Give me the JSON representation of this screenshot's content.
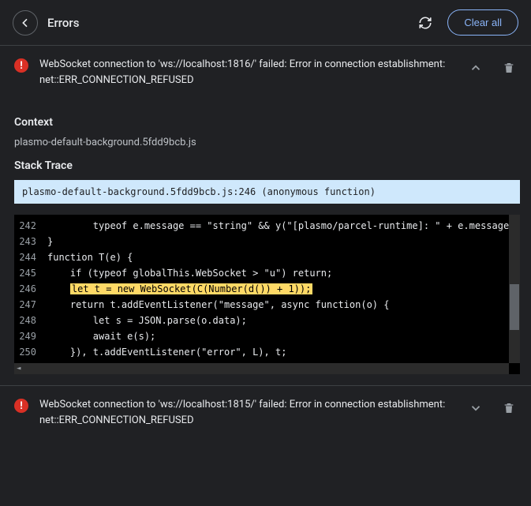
{
  "header": {
    "title": "Errors",
    "clear_label": "Clear all"
  },
  "errors": [
    {
      "message": "WebSocket connection to 'ws://localhost:1816/' failed: Error in connection establishment: net::ERR_CONNECTION_REFUSED",
      "expanded": true,
      "context_title": "Context",
      "context_file": "plasmo-default-background.5fdd9bcb.js",
      "stack_title": "Stack Trace",
      "stack_frame": "plasmo-default-background.5fdd9bcb.js:246 (anonymous function)",
      "code": {
        "highlight_line": 246,
        "lines": [
          {
            "n": 242,
            "t": "        typeof e.message == \"string\" && y(\"[plasmo/parcel-runtime]: \" + e.message);"
          },
          {
            "n": 243,
            "t": "}"
          },
          {
            "n": 244,
            "t": "function T(e) {"
          },
          {
            "n": 245,
            "t": "    if (typeof globalThis.WebSocket > \"u\") return;"
          },
          {
            "n": 246,
            "t": "    let t = new WebSocket(C(Number(d()) + 1));"
          },
          {
            "n": 247,
            "t": "    return t.addEventListener(\"message\", async function(o) {"
          },
          {
            "n": 248,
            "t": "        let s = JSON.parse(o.data);"
          },
          {
            "n": 249,
            "t": "        await e(s);"
          },
          {
            "n": 250,
            "t": "    }), t.addEventListener(\"error\", L), t;"
          }
        ]
      }
    },
    {
      "message": "WebSocket connection to 'ws://localhost:1815/' failed: Error in connection establishment: net::ERR_CONNECTION_REFUSED",
      "expanded": false
    }
  ]
}
